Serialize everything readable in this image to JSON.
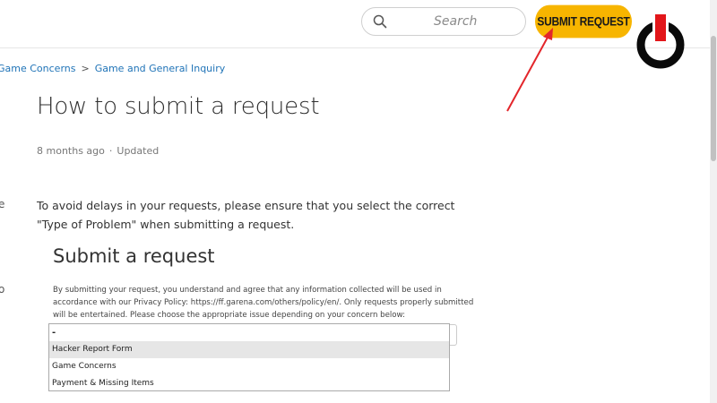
{
  "header": {
    "search_placeholder": "Search",
    "submit_label": "SUBMIT REQUEST",
    "logo": "power-icon",
    "accent": "#f7b500",
    "logo_red": "#e2161a"
  },
  "breadcrumb": {
    "items": [
      "Game Concerns",
      "Game and General Inquiry"
    ],
    "separator": ">"
  },
  "sidebar": {
    "partial_1": "e",
    "partial_2": "o"
  },
  "article": {
    "title": "How to submit a request",
    "time": "8 months ago",
    "meta_separator": "·",
    "updated": "Updated",
    "body": "To avoid delays in your requests, please ensure that you select the correct \"Type of Problem\" when submitting a request."
  },
  "embedded_form": {
    "title": "Submit a request",
    "description": "By submitting your request, you understand and agree that any information collected will be used in accordance with our Privacy Policy: https://ff.garena.com/others/policy/en/. Only requests properly submitted will be entertained. Please choose the appropriate issue depending on your concern below:",
    "selected": "-",
    "options": [
      "Hacker Report Form",
      "Game Concerns",
      "Payment & Missing Items"
    ]
  },
  "annotation": {
    "color": "#e3262b"
  }
}
